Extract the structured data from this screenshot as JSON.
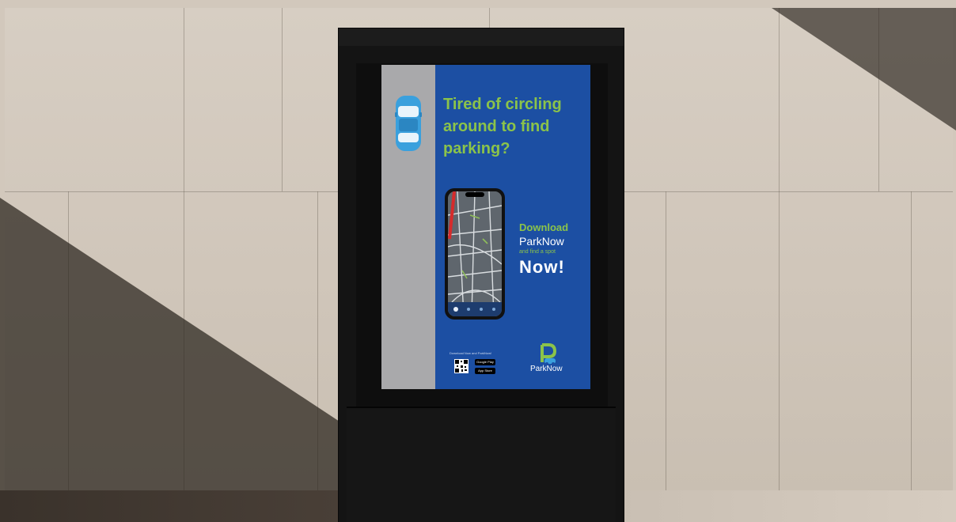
{
  "poster": {
    "headline": [
      "Tired of circling",
      "around to find",
      "parking?"
    ],
    "cta": {
      "download": "Download",
      "brand": "ParkNow",
      "sub": "and find a spot",
      "now": "Now",
      "exclaim": "!"
    },
    "footer": {
      "label": "Download Now and ParkNow!",
      "google_play": "Google Play",
      "app_store": "App Store"
    },
    "logo_text": "ParkNow"
  },
  "colors": {
    "poster_blue": "#1c4fa3",
    "accent_green": "#8bc34a",
    "strip_grey": "#a9a9ab",
    "car_blue": "#3aa0dd"
  },
  "icons": [
    "car-icon",
    "phone-icon",
    "map-icon",
    "qr-code-icon",
    "google-play-badge-icon",
    "app-store-badge-icon",
    "parknow-logo-icon"
  ]
}
